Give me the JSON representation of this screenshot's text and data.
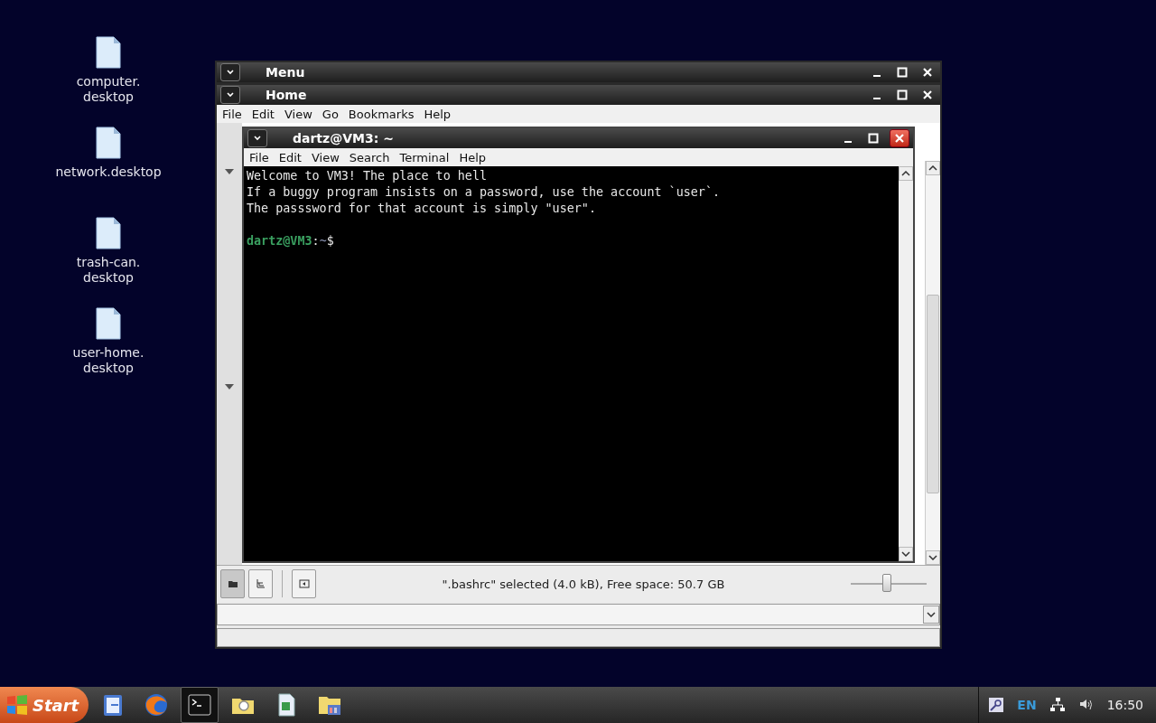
{
  "desktop_icons": [
    {
      "label": "computer.\ndesktop"
    },
    {
      "label": "network.desktop"
    },
    {
      "label": "trash-can.\ndesktop"
    },
    {
      "label": "user-home.\ndesktop"
    }
  ],
  "menu_window": {
    "title": "Menu"
  },
  "home_window": {
    "title": "Home",
    "menu": [
      "File",
      "Edit",
      "View",
      "Go",
      "Bookmarks",
      "Help"
    ],
    "side_buttons": [
      {
        "kind": "folder",
        "selected": true
      },
      {
        "kind": "tree",
        "selected": false
      },
      {
        "kind": "panel",
        "selected": false
      }
    ],
    "status": "\".bashrc\" selected (4.0 kB), Free space: 50.7 GB",
    "zoom": {
      "level": 0.48
    }
  },
  "terminal_window": {
    "title": "dartz@VM3: ~",
    "menu": [
      "File",
      "Edit",
      "View",
      "Search",
      "Terminal",
      "Help"
    ],
    "lines": [
      "Welcome to VM3! The place to hell",
      "If a buggy program insists on a password, use the account `user`.",
      "The passsword for that account is simply \"user\"."
    ],
    "prompt": {
      "user_host": "dartz@VM3",
      "separator": ":",
      "path": "~",
      "symbol": "$"
    }
  },
  "taskbar": {
    "start": "Start",
    "apps": [
      {
        "kind": "clipboard",
        "selected": false
      },
      {
        "kind": "globe",
        "selected": false
      },
      {
        "kind": "terminal",
        "selected": true
      },
      {
        "kind": "folder-search",
        "selected": false
      },
      {
        "kind": "document",
        "selected": false
      },
      {
        "kind": "folder-grid",
        "selected": false
      }
    ],
    "language": "EN",
    "clock": "16:50"
  }
}
